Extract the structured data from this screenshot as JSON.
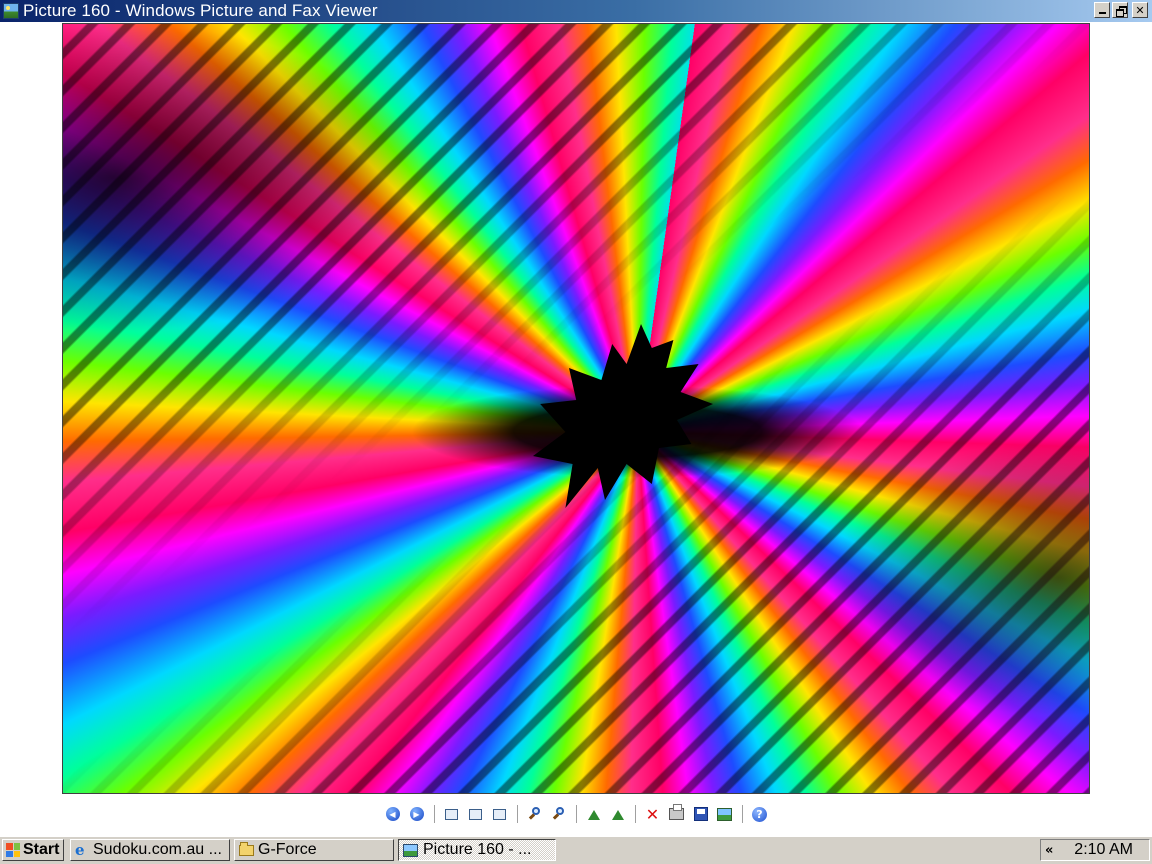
{
  "window": {
    "title": "Picture 160 - Windows Picture and Fax Viewer",
    "controls": {
      "minimize": "minimize",
      "restore": "restore",
      "close": "close"
    }
  },
  "image": {
    "description_icon": "psychedelic-fractal-image",
    "colors": {
      "magenta": "#ff00ff",
      "pink": "#ff0066",
      "orange": "#ff6a00",
      "yellow": "#ffe500",
      "green": "#6bff00",
      "cyan": "#00d8ff",
      "blue": "#1e4bff",
      "black": "#000000"
    }
  },
  "toolbar": {
    "buttons": [
      {
        "icon": "previous-image-icon",
        "glyph": "⏮"
      },
      {
        "icon": "next-image-icon",
        "glyph": "⏭"
      },
      {
        "icon": "best-fit-icon"
      },
      {
        "icon": "actual-size-icon"
      },
      {
        "icon": "slideshow-icon"
      },
      {
        "icon": "zoom-in-icon"
      },
      {
        "icon": "zoom-out-icon"
      },
      {
        "icon": "rotate-clockwise-icon"
      },
      {
        "icon": "rotate-counterclockwise-icon"
      },
      {
        "icon": "delete-icon",
        "glyph": "✕"
      },
      {
        "icon": "print-icon"
      },
      {
        "icon": "save-icon"
      },
      {
        "icon": "edit-icon"
      },
      {
        "icon": "help-icon",
        "glyph": "?"
      }
    ]
  },
  "taskbar": {
    "start_label": "Start",
    "tasks": [
      {
        "label": "Sudoku.com.au ...",
        "icon": "internet-explorer-icon",
        "glyph": "e"
      },
      {
        "label": "G-Force",
        "icon": "folder-icon"
      },
      {
        "label": "Picture 160 - ...",
        "icon": "picture-viewer-icon",
        "active": true
      }
    ],
    "tray_arrow": "«",
    "clock": "2:10 AM"
  }
}
